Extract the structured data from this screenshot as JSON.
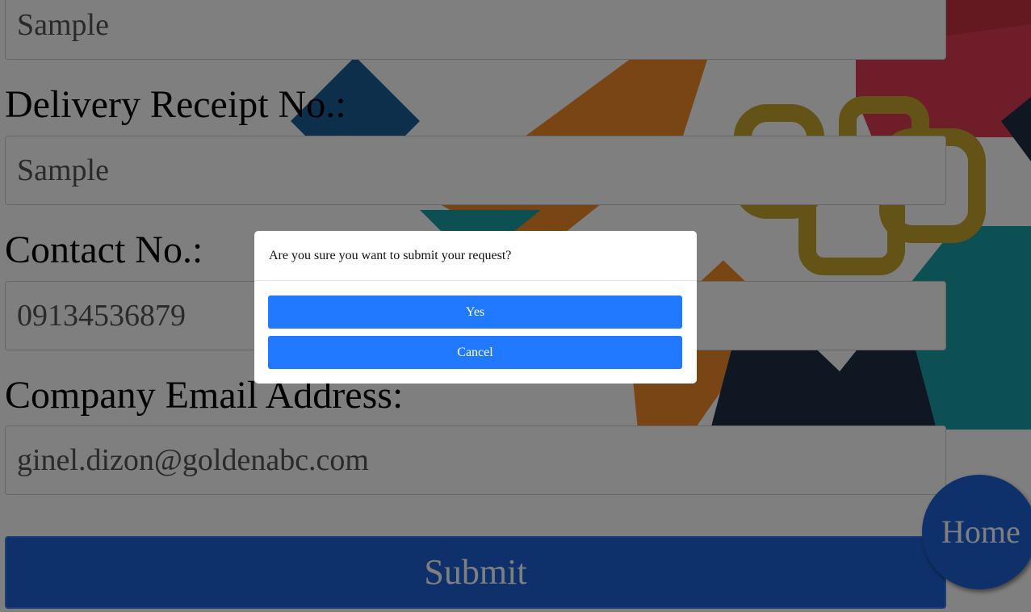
{
  "form": {
    "fields": [
      {
        "label": "",
        "value": "Sample"
      },
      {
        "label": "Delivery Receipt No.:",
        "value": "Sample"
      },
      {
        "label": "Contact No.:",
        "value": "09134536879"
      },
      {
        "label": "Company Email Address:",
        "value": "ginel.dizon@goldenabc.com"
      }
    ],
    "submit_label": "Submit"
  },
  "home_label": "Home",
  "dialog": {
    "message": "Are you sure you want to submit your request?",
    "yes_label": "Yes",
    "cancel_label": "Cancel"
  },
  "colors": {
    "primary_blue": "#1f62d6",
    "dialog_button_blue": "#2079ff",
    "overlay": "rgba(0,0,0,0.5)"
  }
}
